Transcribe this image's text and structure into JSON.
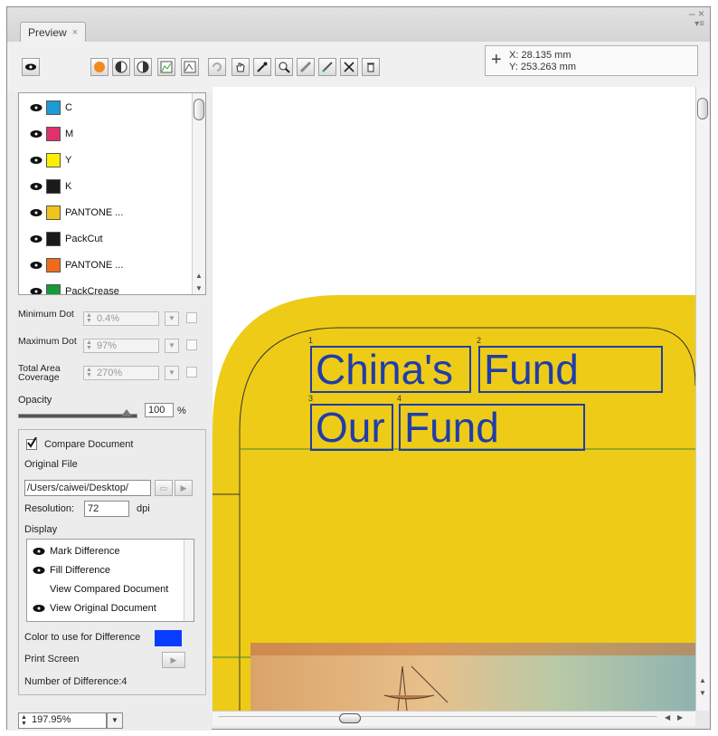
{
  "tab": {
    "title": "Preview",
    "close": "×"
  },
  "window_controls": {
    "minimize": "–",
    "close": "×",
    "menu": "▾≡"
  },
  "coordinates": {
    "x_label": "X:",
    "x_value": "28.135 mm",
    "y_label": "Y:",
    "y_value": "253.263 mm"
  },
  "toolbar_icons": [
    "eye-icon",
    "color-circle-icon",
    "half-circle-icon",
    "contrast-icon",
    "histogram-icon",
    "rotate-icon",
    "hand-icon",
    "eyedropper-icon",
    "zoom-icon",
    "ruler-icon",
    "edit-icon",
    "x-mark-icon",
    "trash-icon"
  ],
  "separations": [
    {
      "name": "C",
      "color": "#1e9ad6"
    },
    {
      "name": "M",
      "color": "#e0306e"
    },
    {
      "name": "Y",
      "color": "#ffee00"
    },
    {
      "name": "K",
      "color": "#1a1a1a"
    },
    {
      "name": "PANTONE ...",
      "color": "#f0c419"
    },
    {
      "name": "PackCut",
      "color": "#1a1a1a"
    },
    {
      "name": "PANTONE ...",
      "color": "#f06a1e"
    },
    {
      "name": "PackCrease",
      "color": "#159b3c"
    }
  ],
  "controls": {
    "min_dot_label": "Minimum Dot",
    "min_dot_value": "0.4%",
    "max_dot_label": "Maximum Dot",
    "max_dot_value": "97%",
    "tac_label": "Total Area Coverage",
    "tac_value": "270%",
    "opacity_label": "Opacity",
    "opacity_value": "100",
    "opacity_unit": "%"
  },
  "compare": {
    "compare_label": "Compare Document",
    "original_file_label": "Original File",
    "original_file_path": "/Users/caiwei/Desktop/",
    "resolution_label": "Resolution:",
    "resolution_value": "72",
    "resolution_unit": "dpi",
    "display_label": "Display",
    "display_options": [
      "Mark Difference",
      "Fill Difference",
      "View Compared Document",
      "View Original Document"
    ],
    "color_label": "Color to use for Difference",
    "difference_color": "#0a3cff",
    "print_screen_label": "Print Screen",
    "difference_count_label": "Number of Difference:4"
  },
  "zoom": {
    "value": "197.95%"
  },
  "document": {
    "boxes": [
      {
        "num": "1",
        "text": "China's"
      },
      {
        "num": "2",
        "text": "Fund"
      },
      {
        "num": "3",
        "text": "Our"
      },
      {
        "num": "4",
        "text": "Fund"
      }
    ],
    "fill_color": "#eecb16",
    "text_color": "#1f3dab"
  }
}
